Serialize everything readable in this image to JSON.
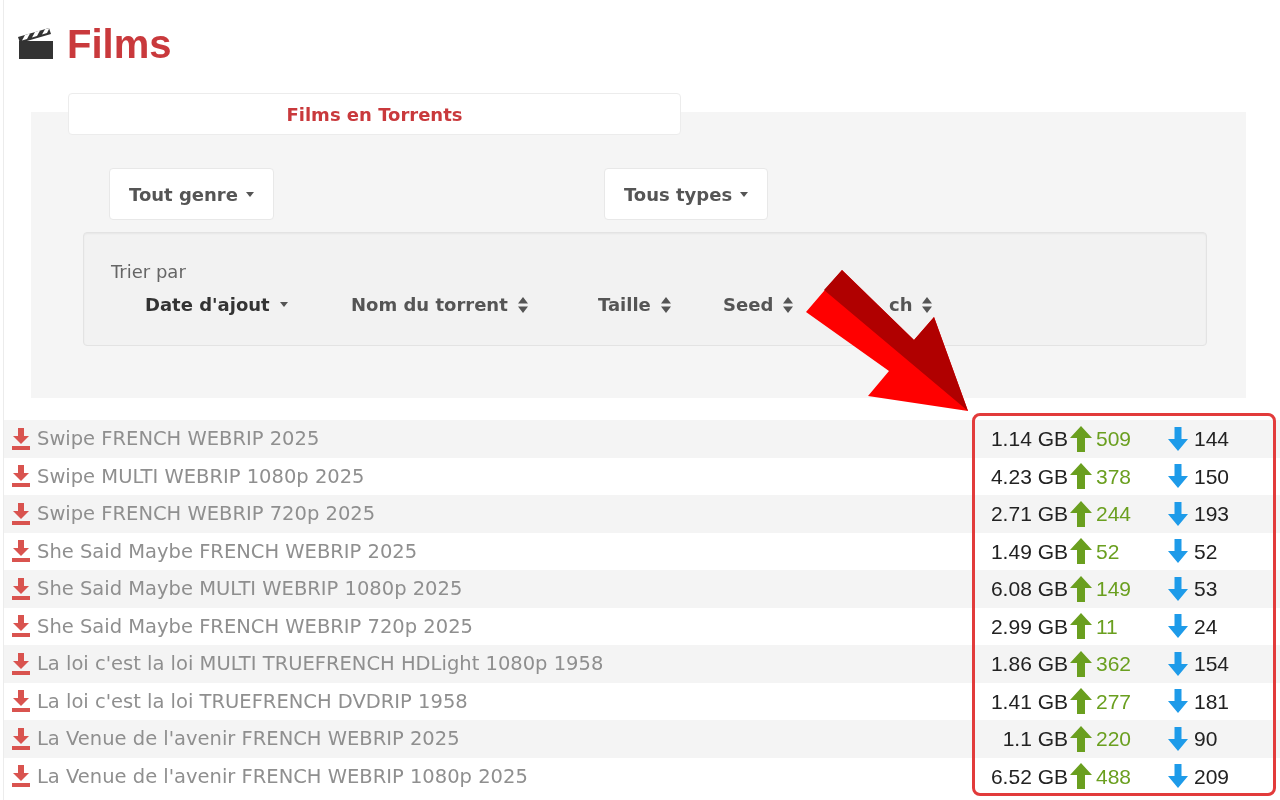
{
  "page": {
    "title": "Films"
  },
  "panel": {
    "tab": {
      "label": "Films en Torrents"
    },
    "filters": [
      {
        "label": "Tout genre"
      },
      {
        "label": "Tous types"
      }
    ],
    "sort": {
      "label": "Trier par",
      "options": [
        {
          "label": "Date d'ajout",
          "selected": true
        },
        {
          "label": "Nom du torrent",
          "selected": false
        },
        {
          "label": "Taille",
          "selected": false
        },
        {
          "label": "Seed",
          "selected": false
        },
        {
          "label": "ch",
          "selected": false
        }
      ]
    }
  },
  "torrents": [
    {
      "name": "Swipe FRENCH WEBRIP 2025",
      "size": "1.14 GB",
      "seeders": "509",
      "leechers": "144"
    },
    {
      "name": "Swipe MULTI WEBRIP 1080p 2025",
      "size": "4.23 GB",
      "seeders": "378",
      "leechers": "150"
    },
    {
      "name": "Swipe FRENCH WEBRIP 720p 2025",
      "size": "2.71 GB",
      "seeders": "244",
      "leechers": "193"
    },
    {
      "name": "She Said Maybe FRENCH WEBRIP 2025",
      "size": "1.49 GB",
      "seeders": "52",
      "leechers": "52"
    },
    {
      "name": "She Said Maybe MULTI WEBRIP 1080p 2025",
      "size": "6.08 GB",
      "seeders": "149",
      "leechers": "53"
    },
    {
      "name": "She Said Maybe FRENCH WEBRIP 720p 2025",
      "size": "2.99 GB",
      "seeders": "11",
      "leechers": "24"
    },
    {
      "name": "La loi c'est la loi MULTI TRUEFRENCH HDLight 1080p 1958",
      "size": "1.86 GB",
      "seeders": "362",
      "leechers": "154"
    },
    {
      "name": "La loi c'est la loi TRUEFRENCH DVDRIP 1958",
      "size": "1.41 GB",
      "seeders": "277",
      "leechers": "181"
    },
    {
      "name": "La Venue de l'avenir FRENCH WEBRIP 2025",
      "size": "1.1 GB",
      "seeders": "220",
      "leechers": "90"
    },
    {
      "name": "La Venue de l'avenir FRENCH WEBRIP 1080p 2025",
      "size": "6.52 GB",
      "seeders": "488",
      "leechers": "209"
    }
  ]
}
